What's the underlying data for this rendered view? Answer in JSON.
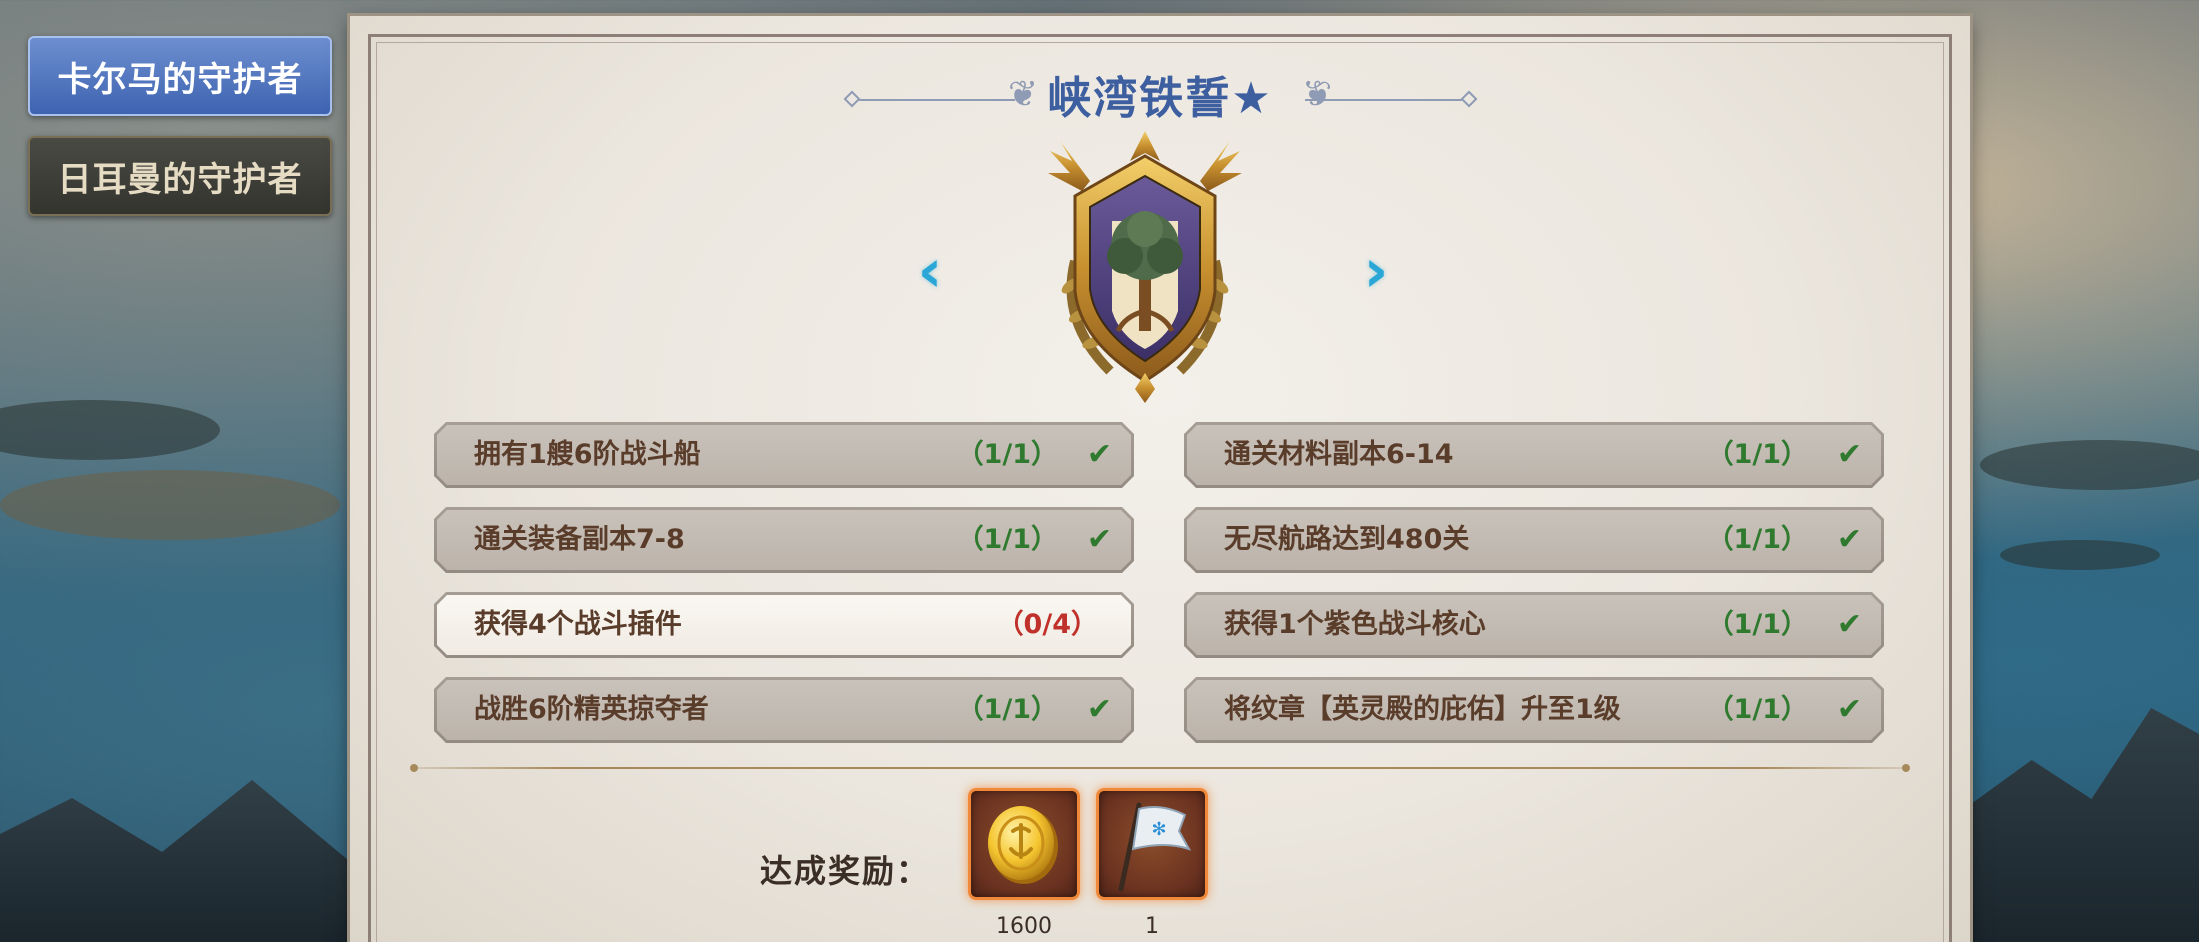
{
  "tabs": [
    {
      "label": "卡尔马的守护者",
      "active": true
    },
    {
      "label": "日耳曼的守护者",
      "active": false
    }
  ],
  "panel": {
    "title": "峡湾铁誓★",
    "prev_icon": "chevron-left-icon",
    "next_icon": "chevron-right-icon",
    "emblem_icon": "tree-crest-emblem"
  },
  "tasks": [
    {
      "label": "拥有1艘6阶战斗船",
      "progress": "（1/1）",
      "done": true
    },
    {
      "label": "通关材料副本6-14",
      "progress": "（1/1）",
      "done": true
    },
    {
      "label": "通关装备副本7-8",
      "progress": "（1/1）",
      "done": true
    },
    {
      "label": "无尽航路达到480关",
      "progress": "（1/1）",
      "done": true
    },
    {
      "label": "获得4个战斗插件",
      "progress": "（0/4）",
      "done": false
    },
    {
      "label": "获得1个紫色战斗核心",
      "progress": "（1/1）",
      "done": true
    },
    {
      "label": "战胜6阶精英掠夺者",
      "progress": "（1/1）",
      "done": true
    },
    {
      "label": "将纹章【英灵殿的庇佑】升至1级",
      "progress": "（1/1）",
      "done": true
    }
  ],
  "check_mark": "✔",
  "rewards": {
    "label": "达成奖励：",
    "items": [
      {
        "icon": "gold-coin-icon",
        "count": "1600"
      },
      {
        "icon": "banner-flag-icon",
        "count": "1"
      }
    ]
  },
  "colors": {
    "title": "#3d5fa0",
    "done": "#2f7a2f",
    "pending": "#c0312b",
    "tab_active": "#4a6fc0",
    "reward_glow": "#f08a3a"
  }
}
